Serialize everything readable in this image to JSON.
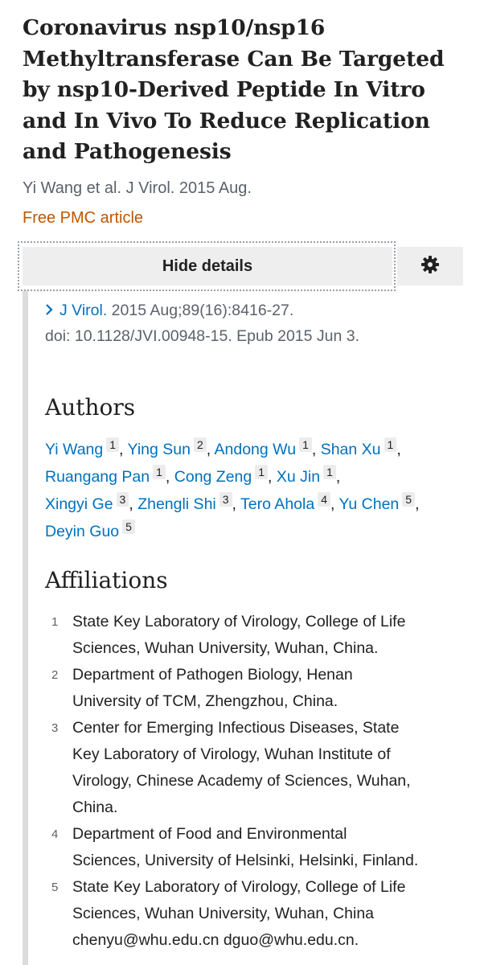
{
  "article": {
    "title": "Coronavirus nsp10/nsp16 Methyltransferase Can Be Targeted by nsp10-Derived Peptide In Vitro and In Vivo To Reduce Replication and Pathogenesis",
    "byline": "Yi Wang et al. J Virol. 2015 Aug.",
    "free_pmc_label": "Free PMC article"
  },
  "details": {
    "toggle_label": "Hide details",
    "settings_icon": "gear-icon",
    "journal_link": "J Virol.",
    "citation_rest": " 2015 Aug;89(16):8416-27.",
    "doi_line": "doi: 10.1128/JVI.00948-15. Epub 2015 Jun 3."
  },
  "authors": {
    "heading": "Authors",
    "list": [
      {
        "name": "Yi Wang",
        "aff": "1"
      },
      {
        "name": "Ying Sun",
        "aff": "2"
      },
      {
        "name": "Andong Wu",
        "aff": "1"
      },
      {
        "name": "Shan Xu",
        "aff": "1"
      },
      {
        "name": "Ruangang Pan",
        "aff": "1"
      },
      {
        "name": "Cong Zeng",
        "aff": "1"
      },
      {
        "name": "Xu Jin",
        "aff": "1"
      },
      {
        "name": "Xingyi Ge",
        "aff": "3"
      },
      {
        "name": "Zhengli Shi",
        "aff": "3"
      },
      {
        "name": "Tero Ahola",
        "aff": "4"
      },
      {
        "name": "Yu Chen",
        "aff": "5"
      },
      {
        "name": "Deyin Guo",
        "aff": "5"
      }
    ]
  },
  "affiliations": {
    "heading": "Affiliations",
    "list": [
      {
        "num": "1",
        "lines": [
          "State Key Laboratory of Virology, College of Life",
          "Sciences, Wuhan University, Wuhan, China."
        ]
      },
      {
        "num": "2",
        "lines": [
          "Department of Pathogen Biology, Henan",
          "University of TCM, Zhengzhou, China."
        ]
      },
      {
        "num": "3",
        "lines": [
          "Center for Emerging Infectious Diseases, State",
          "Key Laboratory of Virology, Wuhan Institute of",
          "Virology, Chinese Academy of Sciences, Wuhan,",
          "China."
        ]
      },
      {
        "num": "4",
        "lines": [
          "Department of Food and Environmental",
          "Sciences, University of Helsinki, Helsinki, Finland."
        ]
      },
      {
        "num": "5",
        "lines": [
          "State Key Laboratory of Virology, College of Life",
          "Sciences, Wuhan University, Wuhan, China",
          "chenyu@whu.edu.cn dguo@whu.edu.cn."
        ]
      }
    ]
  },
  "colors": {
    "link": "#0071bc",
    "free_pmc": "#c05600",
    "muted": "#5b616b",
    "button_bg": "#eeeeee"
  }
}
